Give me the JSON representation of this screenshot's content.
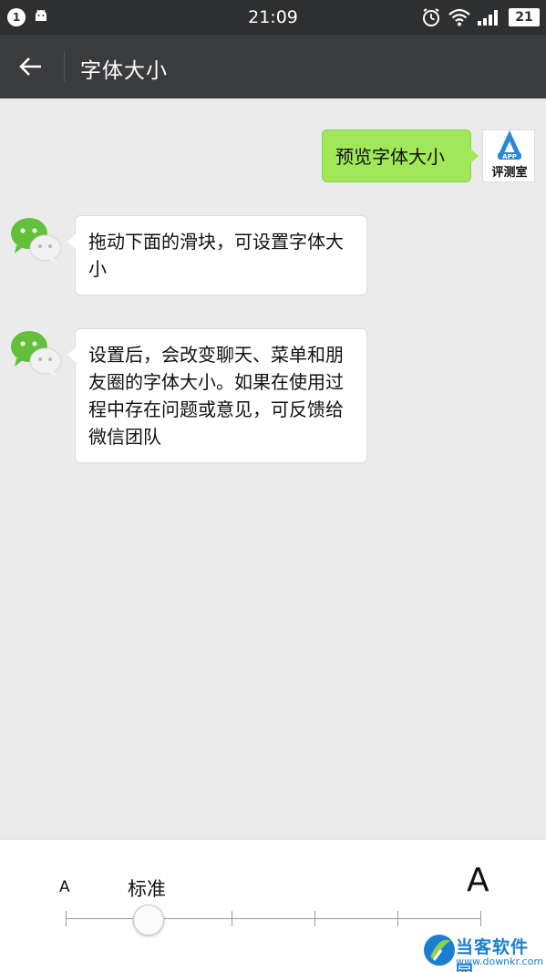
{
  "status_bar": {
    "notification_count": "1",
    "time": "21:09",
    "battery": "21",
    "icons": [
      "android-icon",
      "alarm-icon",
      "wifi-icon",
      "signal-icon",
      "battery-icon"
    ]
  },
  "header": {
    "title": "字体大小",
    "back_icon": "back-arrow-icon"
  },
  "messages": [
    {
      "side": "right",
      "sender": "app-avatar",
      "text": "预览字体大小"
    },
    {
      "side": "left",
      "sender": "wechat-avatar",
      "text": "拖动下面的滑块，可设置字体大小"
    },
    {
      "side": "left",
      "sender": "wechat-avatar",
      "text": "设置后，会改变聊天、菜单和朋友圈的字体大小。如果在使用过程中存在问题或意见，可反馈给微信团队"
    }
  ],
  "avatar_app": {
    "logo_letters": "APP",
    "label": "评测室"
  },
  "font_size_control": {
    "small_label": "A",
    "current_label": "标准",
    "large_label": "A",
    "steps": 6,
    "selected_step": 1
  },
  "watermark": {
    "name": "当客软件园",
    "url": "www.downkr.com"
  },
  "colors": {
    "status_bar": "#2e2f31",
    "title_bar": "#3a3b3d",
    "chat_bg": "#ebebeb",
    "bubble_right": "#a0e75a",
    "bubble_left": "#ffffff",
    "wechat_green": "#62c03a"
  }
}
